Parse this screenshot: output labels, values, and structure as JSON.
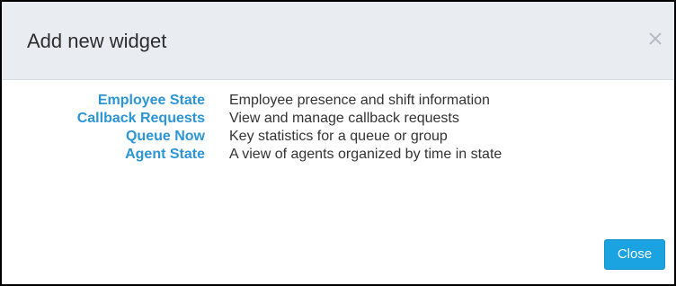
{
  "dialog": {
    "title": "Add new widget",
    "close_icon": "close-x-icon",
    "close_button_label": "Close"
  },
  "widgets": [
    {
      "name": "Employee State",
      "description": "Employee presence and shift information"
    },
    {
      "name": "Callback Requests",
      "description": "View and manage callback requests"
    },
    {
      "name": "Queue Now",
      "description": "Key statistics for a queue or group"
    },
    {
      "name": "Agent State",
      "description": "A view of agents organized by time in state"
    }
  ],
  "colors": {
    "header_background": "#e9edf2",
    "link": "#2b95d6",
    "button": "#1aa3e0",
    "border": "#000000"
  }
}
